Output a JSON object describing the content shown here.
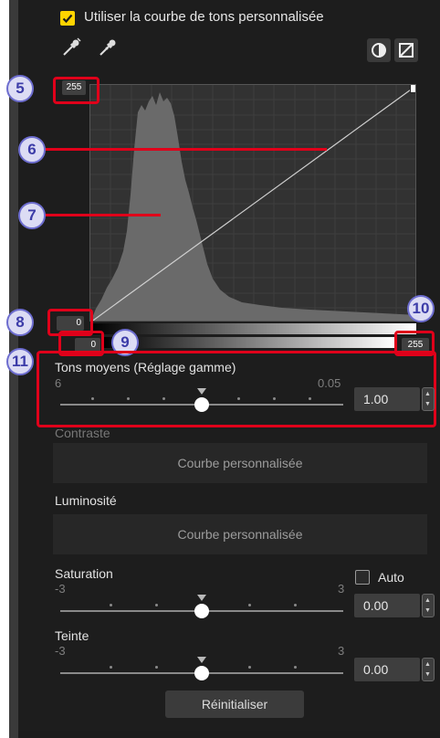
{
  "header": {
    "use_custom_curve_label": "Utiliser la courbe de tons personnalisée",
    "use_custom_curve_checked": true
  },
  "curve": {
    "input_black_value": "0",
    "input_white_value": "255",
    "output_white_value": "255",
    "output_black_value": "0"
  },
  "callouts": [
    "5",
    "6",
    "7",
    "8",
    "9",
    "10",
    "11"
  ],
  "midtones": {
    "label": "Tons moyens (Réglage gamme)",
    "range_min": "6",
    "range_max": "0.05",
    "value": "1.00"
  },
  "contrast": {
    "label": "Contraste",
    "preset": "Courbe personnalisée"
  },
  "brightness": {
    "label": "Luminosité",
    "preset": "Courbe personnalisée"
  },
  "saturation": {
    "label": "Saturation",
    "range_min": "-3",
    "range_max": "3",
    "value": "0.00",
    "auto_label": "Auto",
    "auto_checked": false
  },
  "hue": {
    "label": "Teinte",
    "range_min": "-3",
    "range_max": "3",
    "value": "0.00"
  },
  "reset_label": "Réinitialiser",
  "colors": {
    "accent_checkbox": "#ffd400",
    "callout_red": "#e0001a",
    "callout_circle": "#6d6dcf"
  }
}
